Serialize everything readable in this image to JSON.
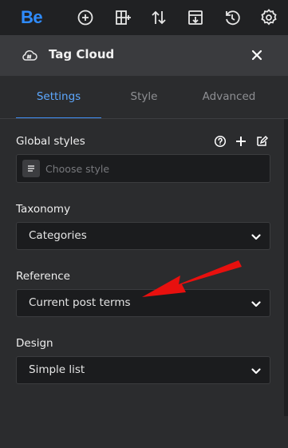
{
  "app": {
    "logo_text": "Be",
    "toolbar_icons": [
      "add-circle-icon",
      "layout-icon",
      "sort-icon",
      "import-icon",
      "history-icon",
      "settings-gear-icon"
    ]
  },
  "panel": {
    "title": "Tag Cloud",
    "icon": "cloud-hash-icon"
  },
  "tabs": [
    {
      "label": "Settings",
      "active": true
    },
    {
      "label": "Style",
      "active": false
    },
    {
      "label": "Advanced",
      "active": false
    }
  ],
  "global_styles": {
    "label": "Global styles",
    "placeholder": "Choose style",
    "actions": [
      "help-icon",
      "add-icon",
      "edit-style-icon"
    ]
  },
  "taxonomy": {
    "label": "Taxonomy",
    "value": "Categories"
  },
  "reference": {
    "label": "Reference",
    "value": "Current post terms"
  },
  "design": {
    "label": "Design",
    "value": "Simple list"
  },
  "colors": {
    "accent": "#3f8ef5",
    "annotation_arrow": "#e8100e",
    "background": "#2b2c2e"
  }
}
